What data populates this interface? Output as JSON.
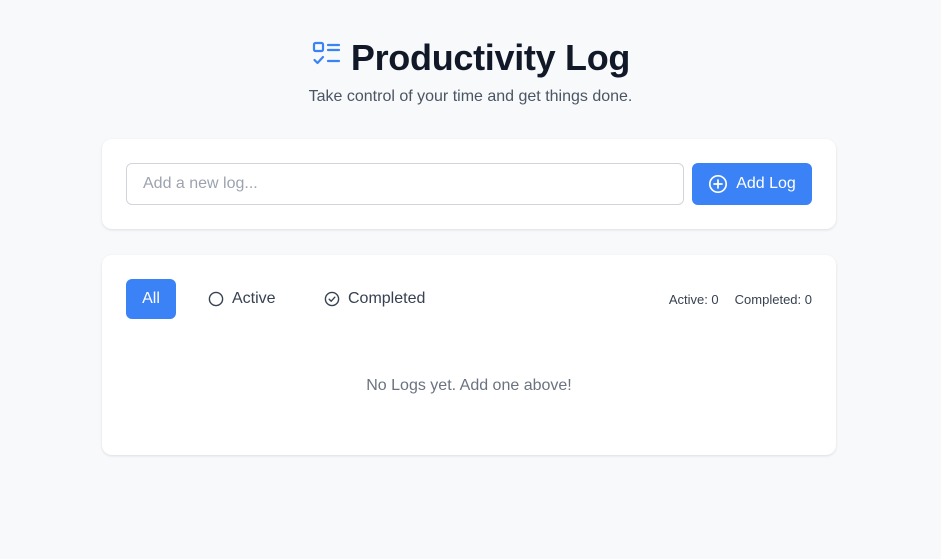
{
  "header": {
    "title": "Productivity Log",
    "subtitle": "Take control of your time and get things done.",
    "icon": "list-check-icon"
  },
  "add_form": {
    "input_placeholder": "Add a new log...",
    "input_value": "",
    "button_label": "Add Log",
    "button_icon": "plus-circle-icon"
  },
  "filters": {
    "all_label": "All",
    "active_label": "Active",
    "completed_label": "Completed",
    "selected": "All"
  },
  "counts": {
    "active_text": "Active: 0",
    "completed_text": "Completed: 0"
  },
  "empty_message": "No Logs yet. Add one above!",
  "colors": {
    "accent": "#3b82f6",
    "background": "#f7f9fb",
    "card": "#ffffff",
    "title": "#111827",
    "muted": "#6b7280"
  }
}
